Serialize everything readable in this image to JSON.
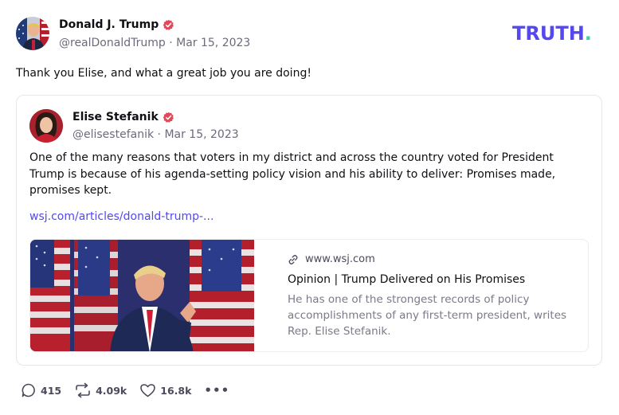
{
  "post": {
    "author_name": "Donald J. Trump",
    "author_handle": "@realDonaldTrump",
    "date": "Mar 15, 2023",
    "text": "Thank you Elise, and what a great job you are doing!"
  },
  "logo": {
    "text": "TRUTH",
    "dot": ".",
    "color": "#5448ee",
    "dot_color": "#3dd0b0"
  },
  "quote": {
    "author_name": "Elise Stefanik",
    "author_handle": "@elisestefanik",
    "date": "Mar 15, 2023",
    "text": "One of the many reasons that voters in my district and across the country voted for President Trump is because of his agenda-setting policy vision and his ability to deliver: Promises made, promises kept.",
    "link_text": "wsj.com/articles/donald-trump-...",
    "card": {
      "domain": "www.wsj.com",
      "title": "Opinion | Trump Delivered on His Promises",
      "description": "He has one of the strongest records of policy accomplishments of any first-term president, writes Rep. Elise Stefanik."
    }
  },
  "actions": {
    "replies": "415",
    "retruths": "4.09k",
    "likes": "16.8k",
    "more": "•••"
  },
  "icons": {
    "verified": "verified-badge-icon",
    "link": "link-icon",
    "reply": "reply-icon",
    "retruth": "retruth-icon",
    "like": "heart-icon",
    "more": "more-icon"
  },
  "colors": {
    "verified": "#e0495a",
    "accent": "#5448ee",
    "muted": "#6b6b7b"
  }
}
